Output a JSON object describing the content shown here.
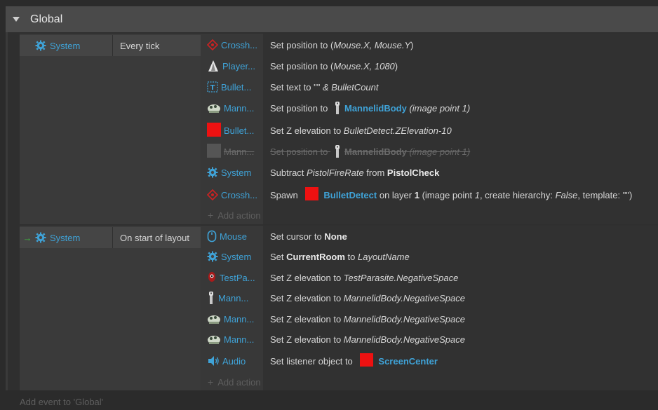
{
  "group": {
    "title": "Global"
  },
  "events": [
    {
      "condition": {
        "object": "System",
        "text": "Every tick",
        "icon": "gear-icon",
        "trigger": false
      },
      "actions": [
        {
          "object": "Crossh...",
          "icon": "crosshair-sprite-icon",
          "parts": [
            {
              "t": "Set position to ("
            },
            {
              "i": "Mouse.X, Mouse.Y"
            },
            {
              "t": ")"
            }
          ],
          "disabled": false
        },
        {
          "object": "Player...",
          "icon": "player-sprite-icon",
          "parts": [
            {
              "t": "Set position to ("
            },
            {
              "i": "Mouse.X, 1080"
            },
            {
              "t": ")"
            }
          ],
          "disabled": false
        },
        {
          "object": "Bullet...",
          "icon": "text-object-icon",
          "parts": [
            {
              "t": "Set text to \"\" "
            },
            {
              "i": "& BulletCount"
            }
          ],
          "disabled": false
        },
        {
          "object": "Mann...",
          "icon": "mannelid-sprite-icon",
          "parts": [
            {
              "t": "Set position to "
            },
            {
              "icon": "mannelid-body-icon"
            },
            {
              "o": "MannelidBody"
            },
            {
              "t": " "
            },
            {
              "i": "(image point 1)"
            }
          ],
          "disabled": false
        },
        {
          "object": "Bullet...",
          "icon": "red-square-icon",
          "parts": [
            {
              "t": "Set Z elevation to "
            },
            {
              "i": "BulletDetect.ZElevation-10"
            }
          ],
          "disabled": false
        },
        {
          "object": "Mann...",
          "icon": "grey-square-icon",
          "parts": [
            {
              "t": "Set position to "
            },
            {
              "icon": "mannelid-body-icon"
            },
            {
              "o": "MannelidBody"
            },
            {
              "t": " "
            },
            {
              "i": "(image point 1)"
            }
          ],
          "disabled": true
        },
        {
          "object": "System",
          "icon": "gear-icon",
          "parts": [
            {
              "t": "Subtract "
            },
            {
              "i": "PistolFireRate"
            },
            {
              "t": " from "
            },
            {
              "b": "PistolCheck"
            }
          ],
          "disabled": false
        },
        {
          "object": "Crossh...",
          "icon": "crosshair-sprite-icon",
          "parts": [
            {
              "t": "Spawn "
            },
            {
              "icon": "red-square-icon"
            },
            {
              "o": "BulletDetect"
            },
            {
              "t": " on layer "
            },
            {
              "b": "1"
            },
            {
              "t": " (image point "
            },
            {
              "i": "1"
            },
            {
              "t": ", create hierarchy: "
            },
            {
              "i": "False"
            },
            {
              "t": ", template: \"\")"
            }
          ],
          "disabled": false
        }
      ],
      "add_action": "Add action"
    },
    {
      "condition": {
        "object": "System",
        "text": "On start of layout",
        "icon": "gear-icon",
        "trigger": true
      },
      "actions": [
        {
          "object": "Mouse",
          "icon": "mouse-icon",
          "parts": [
            {
              "t": "Set cursor to "
            },
            {
              "b": "None"
            }
          ],
          "disabled": false
        },
        {
          "object": "System",
          "icon": "gear-icon",
          "parts": [
            {
              "t": "Set "
            },
            {
              "b": "CurrentRoom"
            },
            {
              "t": " to "
            },
            {
              "i": "LayoutName"
            }
          ],
          "disabled": false
        },
        {
          "object": "TestPa...",
          "icon": "parasite-sprite-icon",
          "parts": [
            {
              "t": "Set Z elevation to "
            },
            {
              "i": "TestParasite.NegativeSpace"
            }
          ],
          "disabled": false
        },
        {
          "object": "Mann...",
          "icon": "mannelid-body-icon",
          "parts": [
            {
              "t": "Set Z elevation to "
            },
            {
              "i": "MannelidBody.NegativeSpace"
            }
          ],
          "disabled": false
        },
        {
          "object": "Mann...",
          "icon": "mannelid-sprite-icon",
          "parts": [
            {
              "t": "Set Z elevation to "
            },
            {
              "i": "MannelidBody.NegativeSpace"
            }
          ],
          "disabled": false
        },
        {
          "object": "Mann...",
          "icon": "mannelid-sprite-icon",
          "parts": [
            {
              "t": "Set Z elevation to "
            },
            {
              "i": "MannelidBody.NegativeSpace"
            }
          ],
          "disabled": false
        },
        {
          "object": "Audio",
          "icon": "speaker-icon",
          "parts": [
            {
              "t": "Set listener object to "
            },
            {
              "icon": "red-square-icon"
            },
            {
              "o": "ScreenCenter"
            }
          ],
          "disabled": false
        }
      ],
      "add_action": "Add action"
    }
  ],
  "add_event": "Add event to 'Global'",
  "colors": {
    "accent": "#3fa3d8",
    "trigger_arrow": "#3dbb3d",
    "red_object": "#ee1111"
  }
}
